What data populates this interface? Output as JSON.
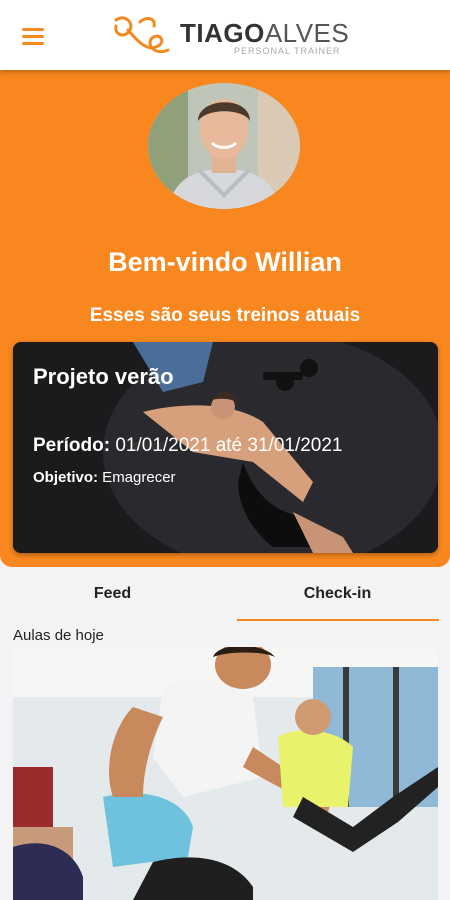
{
  "header": {
    "menu_icon": "hamburger-menu-icon",
    "brand_first": "TIAGO",
    "brand_second": "ALVES",
    "tagline": "PERSONAL TRAINER",
    "accent_color": "#f7871e"
  },
  "hero": {
    "welcome": "Bem-vindo Willian",
    "subtitle": "Esses são seus treinos atuais"
  },
  "workout_card": {
    "title": "Projeto verão",
    "period_label": "Período:",
    "period_value": " 01/01/2021 até 31/01/2021",
    "goal_label": "Objetivo:",
    "goal_value": " Emagrecer"
  },
  "tabs": [
    {
      "label": "Feed",
      "active": false
    },
    {
      "label": "Check-in",
      "active": true
    }
  ],
  "classes_section": {
    "title": "Aulas de hoje"
  }
}
